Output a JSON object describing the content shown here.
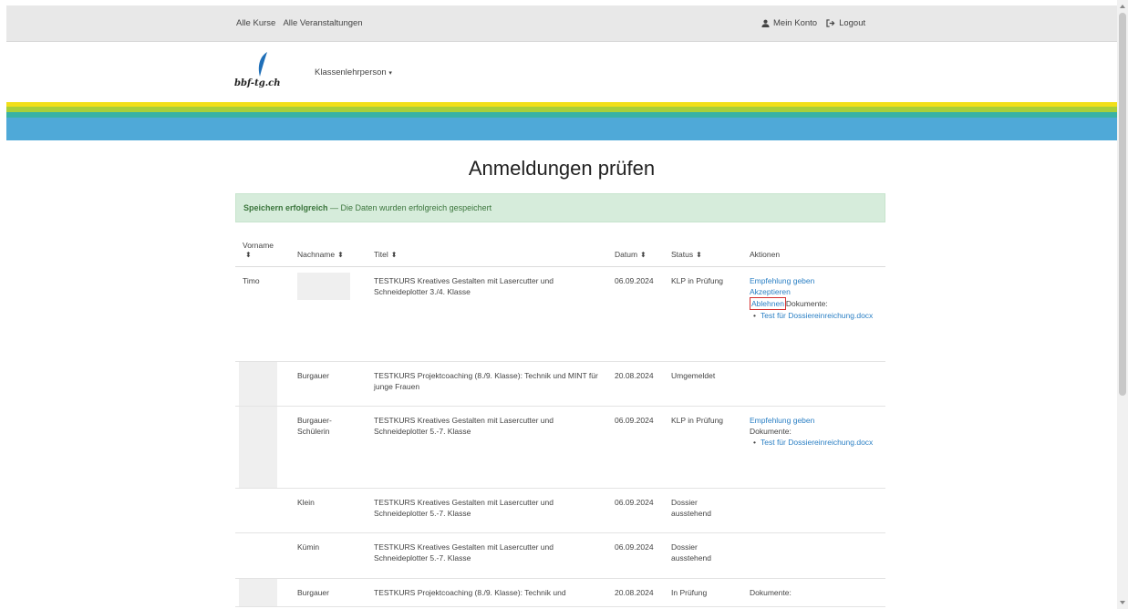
{
  "topbar": {
    "links_left": [
      "Alle Kurse",
      "Alle Veranstaltungen"
    ],
    "account": "Mein Konto",
    "logout": "Logout"
  },
  "header": {
    "logo_text": "bbf-tg.ch",
    "nav": "Klassenlehrperson"
  },
  "stripes": [
    "#f2df1a",
    "#a8cf3b",
    "#38b2a6",
    "#4fa9d8",
    "#4fa9d8"
  ],
  "page": {
    "title": "Anmeldungen prüfen"
  },
  "alert": {
    "strong": "Speichern erfolgreich",
    "text": " — Die Daten wurden erfolgreich gespeichert"
  },
  "table": {
    "headers": {
      "vorname": "Vorname",
      "nachname": "Nachname",
      "titel": "Titel",
      "datum": "Datum",
      "status": "Status",
      "aktionen": "Aktionen"
    },
    "rows": [
      {
        "vorname": "Timo",
        "nachname": "",
        "titel": "TESTKURS Kreatives Gestalten mit Lasercutter und Schneideplotter 3./4. Klasse",
        "datum": "06.09.2024",
        "status": "KLP in Prüfung",
        "actions": {
          "empfehlung": "Empfehlung geben",
          "akzeptieren": "Akzeptieren",
          "ablehnen": "Ablehnen",
          "dokumente_label": "Dokumente:",
          "doc": "Test für Dossiereinreichung.docx"
        }
      },
      {
        "vorname": "",
        "nachname": "Burgauer",
        "titel": "TESTKURS Projektcoaching (8./9. Klasse): Technik und MINT für junge Frauen",
        "datum": "20.08.2024",
        "status": "Umgemeldet"
      },
      {
        "vorname": "",
        "nachname": "Burgauer-Schülerin",
        "titel": "TESTKURS Kreatives Gestalten mit Lasercutter und Schneideplotter 5.-7. Klasse",
        "datum": "06.09.2024",
        "status": "KLP in Prüfung",
        "actions": {
          "empfehlung": "Empfehlung geben",
          "dokumente_label": "Dokumente:",
          "doc": "Test für Dossiereinreichung.docx"
        }
      },
      {
        "vorname": "",
        "nachname": "Klein",
        "titel": "TESTKURS Kreatives Gestalten mit Lasercutter und Schneideplotter 5.-7. Klasse",
        "datum": "06.09.2024",
        "status": "Dossier ausstehend"
      },
      {
        "vorname": "",
        "nachname": "Kümin",
        "titel": "TESTKURS Kreatives Gestalten mit Lasercutter und Schneideplotter 5.-7. Klasse",
        "datum": "06.09.2024",
        "status": "Dossier ausstehend"
      },
      {
        "vorname": "",
        "nachname": "Burgauer",
        "titel": "TESTKURS Projektcoaching (8./9. Klasse): Technik und",
        "datum": "20.08.2024",
        "status": "In Prüfung",
        "actions": {
          "dokumente_label": "Dokumente:"
        }
      }
    ]
  },
  "icons": {
    "account": "user-icon",
    "logout": "logout-icon",
    "sort": "sort-icon",
    "dropdown": "caret-down-icon"
  }
}
